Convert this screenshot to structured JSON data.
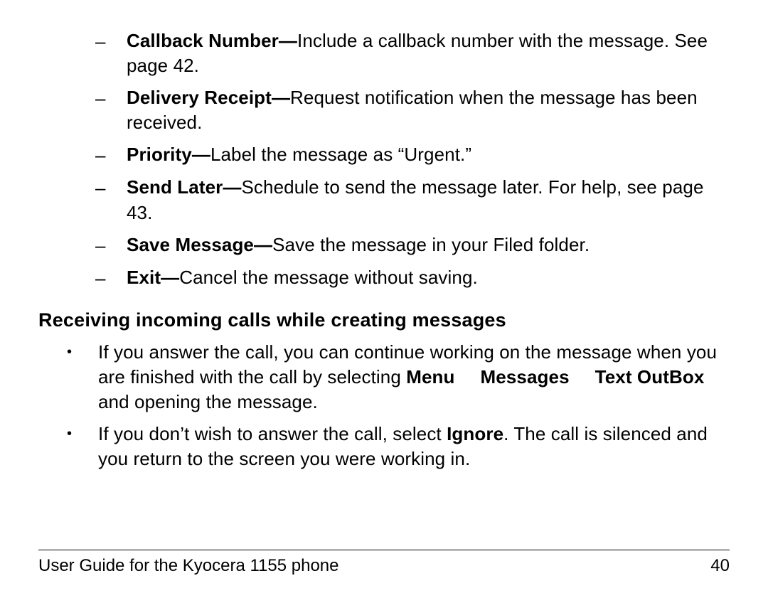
{
  "options": [
    {
      "label": "Callback Number",
      "desc": "Include a callback number with the message. See page 42."
    },
    {
      "label": "Delivery Receipt",
      "desc": "Request notification when the message has been received."
    },
    {
      "label": "Priority",
      "desc": "Label the message as “Urgent.”"
    },
    {
      "label": "Send Later",
      "desc": "Schedule to send the message later. For help, see page 43."
    },
    {
      "label": "Save Message",
      "desc": "Save the message in your Filed folder."
    },
    {
      "label": "Exit",
      "desc": "Cancel the message without saving."
    }
  ],
  "heading": "Receiving incoming calls while creating messages",
  "para1": {
    "pre": "If you answer the call, you can continue working on the message when you are finished with the call by selecting ",
    "nav1": "Menu",
    "nav2": "Messages",
    "nav3": "Text OutBox",
    "post": " and opening the message."
  },
  "para2": {
    "pre": "If you don’t wish to answer the call, select ",
    "bold": "Ignore",
    "post": ". The call is silenced and you return to the screen you were working in."
  },
  "footer": {
    "left": "User Guide for the Kyocera 1155 phone",
    "right": "40"
  }
}
